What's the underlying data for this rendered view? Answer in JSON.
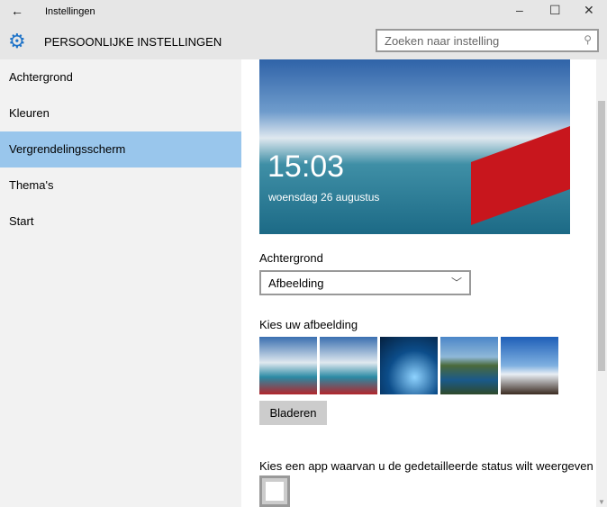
{
  "window": {
    "title": "Instellingen",
    "back": "←",
    "minimize": "–",
    "maximize": "☐",
    "close": "✕"
  },
  "header": {
    "title": "PERSOONLIJKE INSTELLINGEN",
    "search_placeholder": "Zoeken naar instelling"
  },
  "sidebar": {
    "items": [
      {
        "label": "Achtergrond"
      },
      {
        "label": "Kleuren"
      },
      {
        "label": "Vergrendelingsscherm"
      },
      {
        "label": "Thema's"
      },
      {
        "label": "Start"
      }
    ],
    "selected": 2
  },
  "preview": {
    "time": "15:03",
    "date": "woensdag 26 augustus"
  },
  "background": {
    "label": "Achtergrond",
    "value": "Afbeelding"
  },
  "pictures": {
    "label": "Kies uw afbeelding",
    "browse": "Bladeren"
  },
  "app_status": {
    "label": "Kies een app waarvan u de gedetailleerde status wilt weergeven"
  },
  "colors": {
    "accent": "#1e73c8",
    "selected": "#99c6ec"
  }
}
